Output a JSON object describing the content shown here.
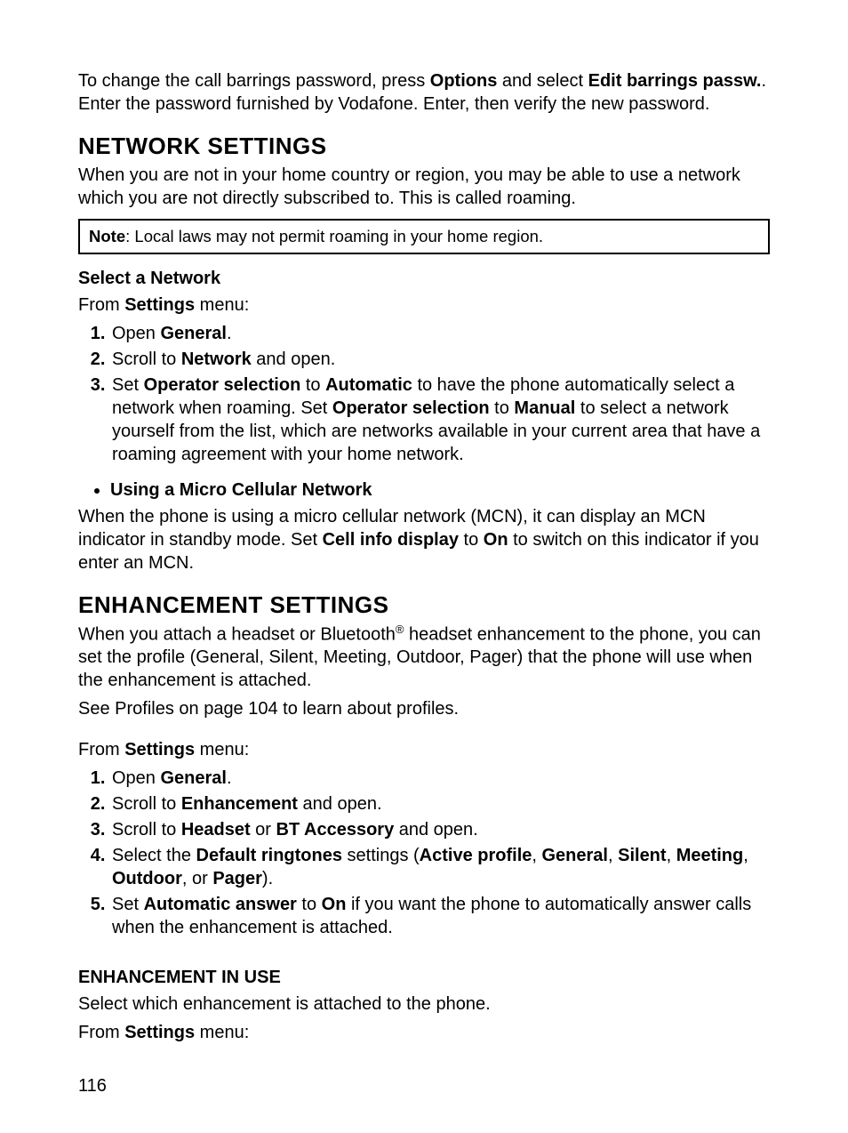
{
  "intro": {
    "pre": "To change the call barrings password, press ",
    "b1": "Options",
    "mid1": " and select ",
    "b2": "Edit barrings passw.",
    "post": ". Enter the password furnished by Vodafone. Enter, then verify the new password."
  },
  "network": {
    "heading": "NETWORK SETTINGS",
    "intro": "When you are not in your home country or region, you may be able to use a network which you are not directly subscribed to. This is called roaming.",
    "note_label": "Note",
    "note_text": ":  Local laws may not permit roaming in your home region.",
    "select_heading": "Select a Network",
    "from_pre": "From ",
    "from_b": "Settings",
    "from_post": " menu:",
    "steps": [
      {
        "pre": "Open ",
        "b1": "General",
        "post": "."
      },
      {
        "pre": "Scroll to ",
        "b1": "Network",
        "post": " and open."
      },
      {
        "pre": "Set ",
        "b1": "Operator selection",
        "mid1": " to ",
        "b2": "Automatic",
        "mid2": " to have the phone automatically select a network when roaming. Set ",
        "b3": "Operator selection",
        "mid3": " to ",
        "b4": "Manual",
        "post": " to select a network yourself from the list, which are networks available in your current area that have a roaming agreement with your home network."
      }
    ],
    "mcn_bullet": "Using a Micro Cellular Network",
    "mcn_pre": "When the phone is using a micro cellular network (MCN), it can display an MCN indicator in standby mode. Set ",
    "mcn_b1": "Cell info display",
    "mcn_mid": " to ",
    "mcn_b2": "On",
    "mcn_post": " to switch on this indicator if you enter an MCN."
  },
  "enh": {
    "heading": "ENHANCEMENT SETTINGS",
    "intro_pre": "When you attach a headset or Bluetooth",
    "intro_sup": "®",
    "intro_post": " headset enhancement to the phone, you can set the profile (General, Silent, Meeting, Outdoor, Pager) that the phone will use when the enhancement is attached.",
    "see": "See Profiles on page 104 to learn about profiles.",
    "from_pre": "From ",
    "from_b": "Settings",
    "from_post": " menu:",
    "steps": [
      {
        "pre": "Open ",
        "b1": "General",
        "post": "."
      },
      {
        "pre": "Scroll to ",
        "b1": "Enhancement",
        "post": " and open."
      },
      {
        "pre": "Scroll to ",
        "b1": "Headset",
        "mid1": " or ",
        "b2": "BT Accessory",
        "post": " and open."
      },
      {
        "pre": "Select the ",
        "b1": "Default ringtones",
        "mid1": " settings (",
        "b2": "Active profile",
        "mid2": ", ",
        "b3": "General",
        "mid3": ", ",
        "b4": "Silent",
        "mid4": ", ",
        "b5": "Meeting",
        "mid5": ", ",
        "b6": "Outdoor",
        "mid6": ", or ",
        "b7": "Pager",
        "post": ")."
      },
      {
        "pre": "Set ",
        "b1": "Automatic answer",
        "mid1": " to ",
        "b2": "On",
        "post": " if you want the phone to automatically answer calls when the enhancement is attached."
      }
    ],
    "inuse_heading": "ENHANCEMENT IN USE",
    "inuse_text": "Select which enhancement is attached to the phone.",
    "inuse_from_pre": "From ",
    "inuse_from_b": "Settings",
    "inuse_from_post": " menu:"
  },
  "page_number": "116"
}
